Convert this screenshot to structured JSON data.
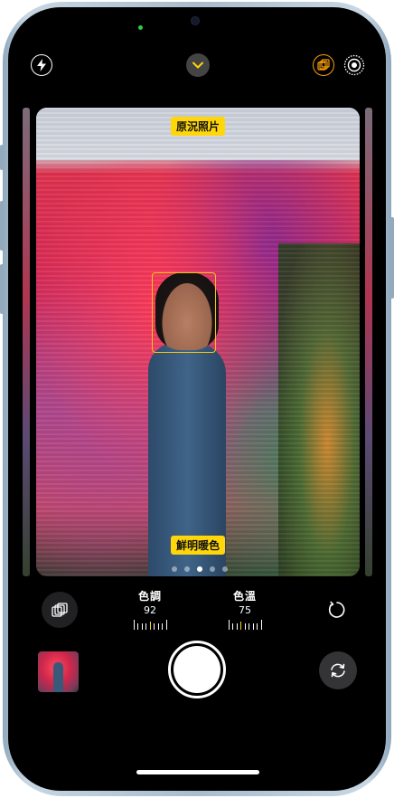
{
  "top_bar": {
    "flash_icon": "bolt-icon",
    "expand_icon": "chevron-down-icon",
    "styles_icon": "photographic-styles-icon",
    "live_icon": "live-photo-icon",
    "accent_color": "#ffd60a",
    "styles_active_color": "#ff9f0a"
  },
  "viewfinder": {
    "style_name": "原況照片",
    "style_subtitle": "鮮明暖色",
    "page_count": 5,
    "active_page": 2
  },
  "adjustments": {
    "tone": {
      "label": "色調",
      "value": "92"
    },
    "warmth": {
      "label": "色溫",
      "value": "75"
    }
  },
  "bottom_bar": {
    "styles_toggle_icon": "photographic-styles-icon",
    "reset_icon": "reset-icon",
    "flip_camera_icon": "camera-flip-icon"
  }
}
